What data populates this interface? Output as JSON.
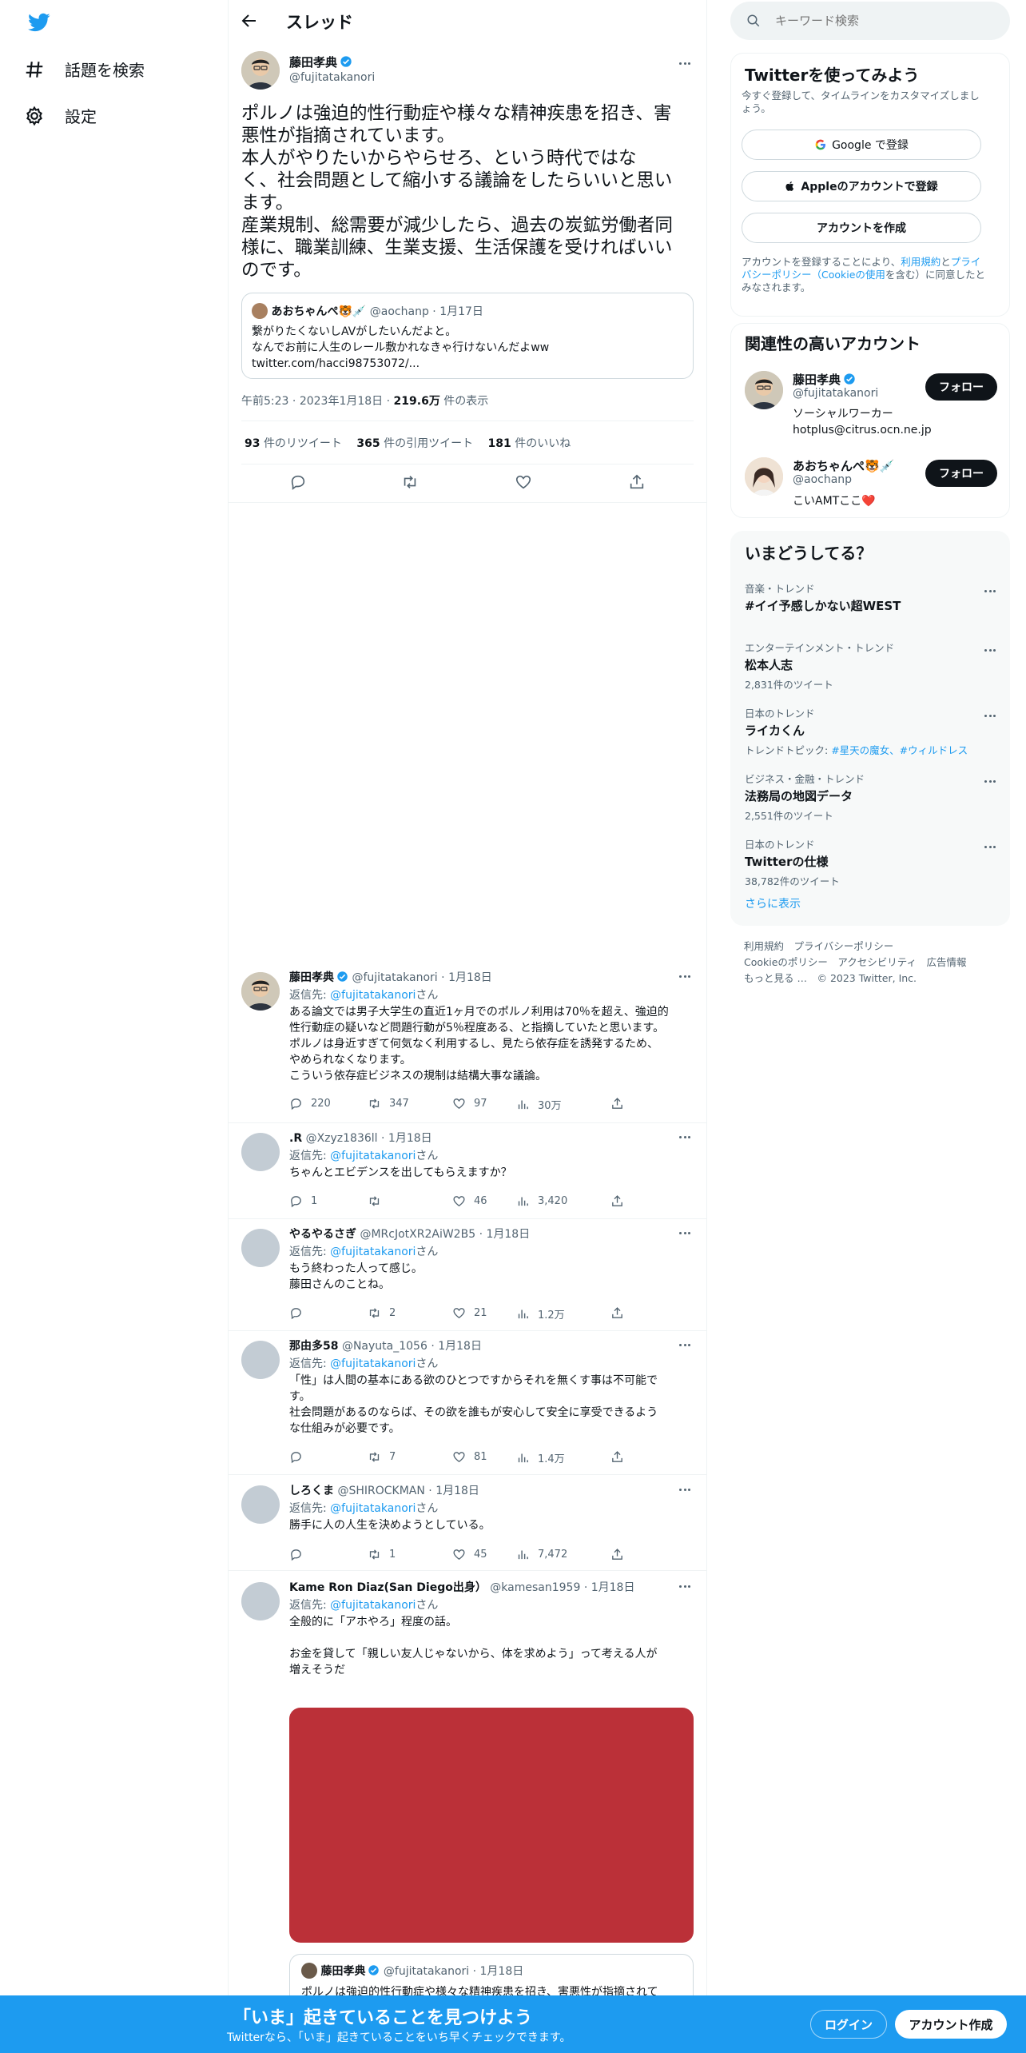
{
  "sidebar": {
    "explore": "話題を検索",
    "settings": "設定"
  },
  "header": {
    "title": "スレッド"
  },
  "main_tweet": {
    "name": "藤田孝典",
    "handle": "@fujitatakanori",
    "text_lines": [
      "ポルノは強迫的性行動症や様々な精神疾患を招き、害",
      "悪性が指摘されています。",
      "本人がやりたいからやらせろ、という時代ではな",
      "く、社会問題として縮小する議論をしたらいいと思い",
      "ます。",
      "産業規制、総需要が減少したら、過去の炭鉱労働者同",
      "様に、職業訓練、生業支援、生活保護を受ければいい",
      "のです。"
    ],
    "quote": {
      "name": "あおちゃんぺ🐯💉",
      "handle": "@aochanp",
      "date": "1月17日",
      "lines": [
        "繋がりたくないしAVがしたいんだよと。",
        "なんでお前に人生のレール敷かれなきゃ行けないんだよww",
        "twitter.com/hacci98753072/..."
      ]
    },
    "time": "午前5:23",
    "date": "2023年1月18日",
    "views": "219.6万",
    "views_label": "件の表示",
    "retweets": "93",
    "retweets_label": "件のリツイート",
    "quotes": "365",
    "quotes_label": "件の引用ツイート",
    "likes": "181",
    "likes_label": "件のいいね"
  },
  "replies": [
    {
      "name": "藤田孝典",
      "handle": "@fujitatakanori",
      "date": "1月18日",
      "reply_prefix": "返信先:",
      "reply_to": "@fujitatakanori",
      "reply_suffix": "さん",
      "lines": [
        "ある論文では男子大学生の直近1ヶ月でのポルノ利用は70％を超え、強迫的",
        "性行動症の疑いなど問題行動が5％程度ある、と指摘していたと思います。",
        "ポルノは身近すぎて何気なく利用するし、見たら依存症を誘発するため、",
        "やめられなくなります。",
        "こういう依存症ビジネスの規制は結構大事な議論。"
      ],
      "stats": {
        "reply": "220",
        "retweet": "347",
        "like": "97",
        "views": "30万"
      }
    },
    {
      "name": ".R",
      "handle": "@Xzyz1836ll",
      "date": "1月18日",
      "reply_prefix": "返信先:",
      "reply_to": "@fujitatakanori",
      "reply_suffix": "さん",
      "lines": [
        "ちゃんとエビデンスを出してもらえますか？"
      ],
      "stats": {
        "reply": "1",
        "retweet": "",
        "like": "46",
        "views": "3,420"
      }
    },
    {
      "name": "やるやるさぎ",
      "handle": "@MRcJotXR2AiW2B5",
      "date": "1月18日",
      "reply_prefix": "返信先:",
      "reply_to": "@fujitatakanori",
      "reply_suffix": "さん",
      "lines": [
        "もう終わった人って感じ。",
        "藤田さんのことね。"
      ],
      "stats": {
        "reply": "",
        "retweet": "2",
        "like": "21",
        "views": "1.2万"
      }
    },
    {
      "name": "那由多58",
      "handle": "@Nayuta_1056",
      "date": "1月18日",
      "reply_prefix": "返信先:",
      "reply_to": "@fujitatakanori",
      "reply_suffix": "さん",
      "lines": [
        "「性」は人間の基本にある欲のひとつですからそれを無くす事は不可能で",
        "す。",
        "社会問題があるのならば、その欲を誰もが安心して安全に享受できるよう",
        "な仕組みが必要です。"
      ],
      "stats": {
        "reply": "",
        "retweet": "7",
        "like": "81",
        "views": "1.4万"
      }
    },
    {
      "name": "しろくま",
      "handle": "@SHIROCKMAN",
      "date": "1月18日",
      "reply_prefix": "返信先:",
      "reply_to": "@fujitatakanori",
      "reply_suffix": "さん",
      "lines": [
        "勝手に人の人生を決めようとしている。"
      ],
      "stats": {
        "reply": "",
        "retweet": "1",
        "like": "45",
        "views": "7,472"
      }
    },
    {
      "name": "Kame Ron Diaz(San Diego出身）",
      "handle": "@kamesan1959",
      "date": "1月18日",
      "reply_prefix": "返信先:",
      "reply_to": "@fujitatakanori",
      "reply_suffix": "さん",
      "lines": [
        "全般的に「アホやろ」程度の話。",
        "",
        "お金を貸して「親しい友人じゃないから、体を求めよう」って考える人が",
        "増えそうだ"
      ],
      "stats": {
        "reply": "",
        "retweet": "",
        "like": "",
        "views": ""
      },
      "embedded": {
        "name": "藤田孝典",
        "handle": "@fujitatakanori",
        "date": "1月18日",
        "text": "ポルノは強迫的性行動症や様々な精神疾患を招き、害悪性が指摘されて"
      }
    }
  ],
  "search": {
    "placeholder": "キーワード検索"
  },
  "signup": {
    "title": "Twitterを使ってみよう",
    "subtitle_1": "今すぐ登録して、タイムラインをカスタマイズしまし",
    "subtitle_2": "ょう。",
    "google": "Google で登録",
    "apple": "Appleのアカウントで登録",
    "create": "アカウントを作成",
    "terms_1a": "アカウントを登録することにより、",
    "terms_1b": "利用規約",
    "terms_1c": "と",
    "terms_1d": "プライ",
    "terms_2a": "バシーポリシー（Cookieの使用",
    "terms_2b": "を含む）に同意したと",
    "terms_3": "みなされます。"
  },
  "related": {
    "title": "関連性の高いアカウント",
    "follow_label": "フォロー",
    "accounts": [
      {
        "name": "藤田孝典",
        "handle": "@fujitatakanori",
        "bio_1": "ソーシャルワーカー",
        "bio_2": "hotplus@citrus.ocn.ne.jp"
      },
      {
        "name": "あおちゃんぺ🐯💉",
        "handle": "@aochanp",
        "bio_1": "こいAMTここ❤️",
        "bio_2": ""
      }
    ]
  },
  "trends": {
    "title": "いまどうしてる？",
    "items": [
      {
        "category": "音楽・トレンド",
        "name": "#イイ予感しかない超WEST",
        "count": ""
      },
      {
        "category": "エンターテインメント・トレンド",
        "name": "松本人志",
        "count": "2,831件のツイート"
      },
      {
        "category": "日本のトレンド",
        "name": "ライカくん",
        "count": "",
        "topics_label": "トレンドトピック:",
        "topics": "#星天の魔女、#ウィルドレス"
      },
      {
        "category": "ビジネス・金融・トレンド",
        "name": "法務局の地図データ",
        "count": "2,551件のツイート"
      },
      {
        "category": "日本のトレンド",
        "name": "Twitterの仕様",
        "count": "38,782件のツイート"
      }
    ],
    "show_more": "さらに表示"
  },
  "footer": {
    "line1": "利用規約　プライバシーポリシー",
    "line2": "Cookieのポリシー　アクセシビリティ　広告情報",
    "line3": "もっと見る …　© 2023 Twitter, Inc."
  },
  "bottom_bar": {
    "title": "「いま」起きていることを見つけよう",
    "subtitle": "Twitterなら、「いま」起きていることをいち早くチェックできます。",
    "login": "ログイン",
    "signup": "アカウント作成"
  },
  "colors": {
    "brand": "#1d9bf0",
    "text": "#0f1419",
    "muted": "#536471",
    "media": "#bb3038"
  }
}
